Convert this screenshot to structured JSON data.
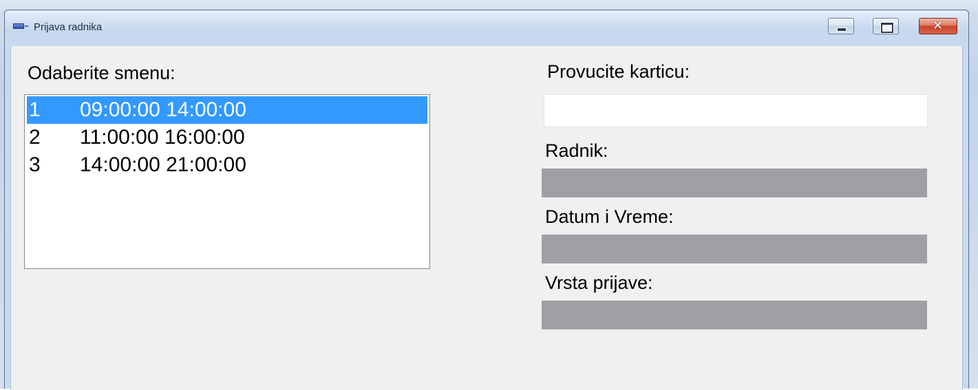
{
  "window": {
    "title": "Prijava radnika",
    "controls": {
      "minimize": "minimize",
      "maximize": "maximize",
      "close": "✕"
    }
  },
  "shift_panel": {
    "label": "Odaberite smenu:",
    "items": [
      {
        "id": "1",
        "times": "09:00:00 14:00:00",
        "selected": true
      },
      {
        "id": "2",
        "times": "11:00:00 16:00:00",
        "selected": false
      },
      {
        "id": "3",
        "times": "14:00:00 21:00:00",
        "selected": false
      }
    ]
  },
  "card_panel": {
    "label": "Provucite karticu:",
    "value": "",
    "placeholder": ""
  },
  "worker": {
    "label": "Radnik:",
    "value": ""
  },
  "datetime": {
    "label": "Datum i Vreme:",
    "value": ""
  },
  "login_type": {
    "label": "Vrsta prijave:",
    "value": ""
  },
  "colors": {
    "selection": "#3399ff",
    "readonly_field": "#a0a0a4",
    "client_background": "#f0f0f0"
  }
}
